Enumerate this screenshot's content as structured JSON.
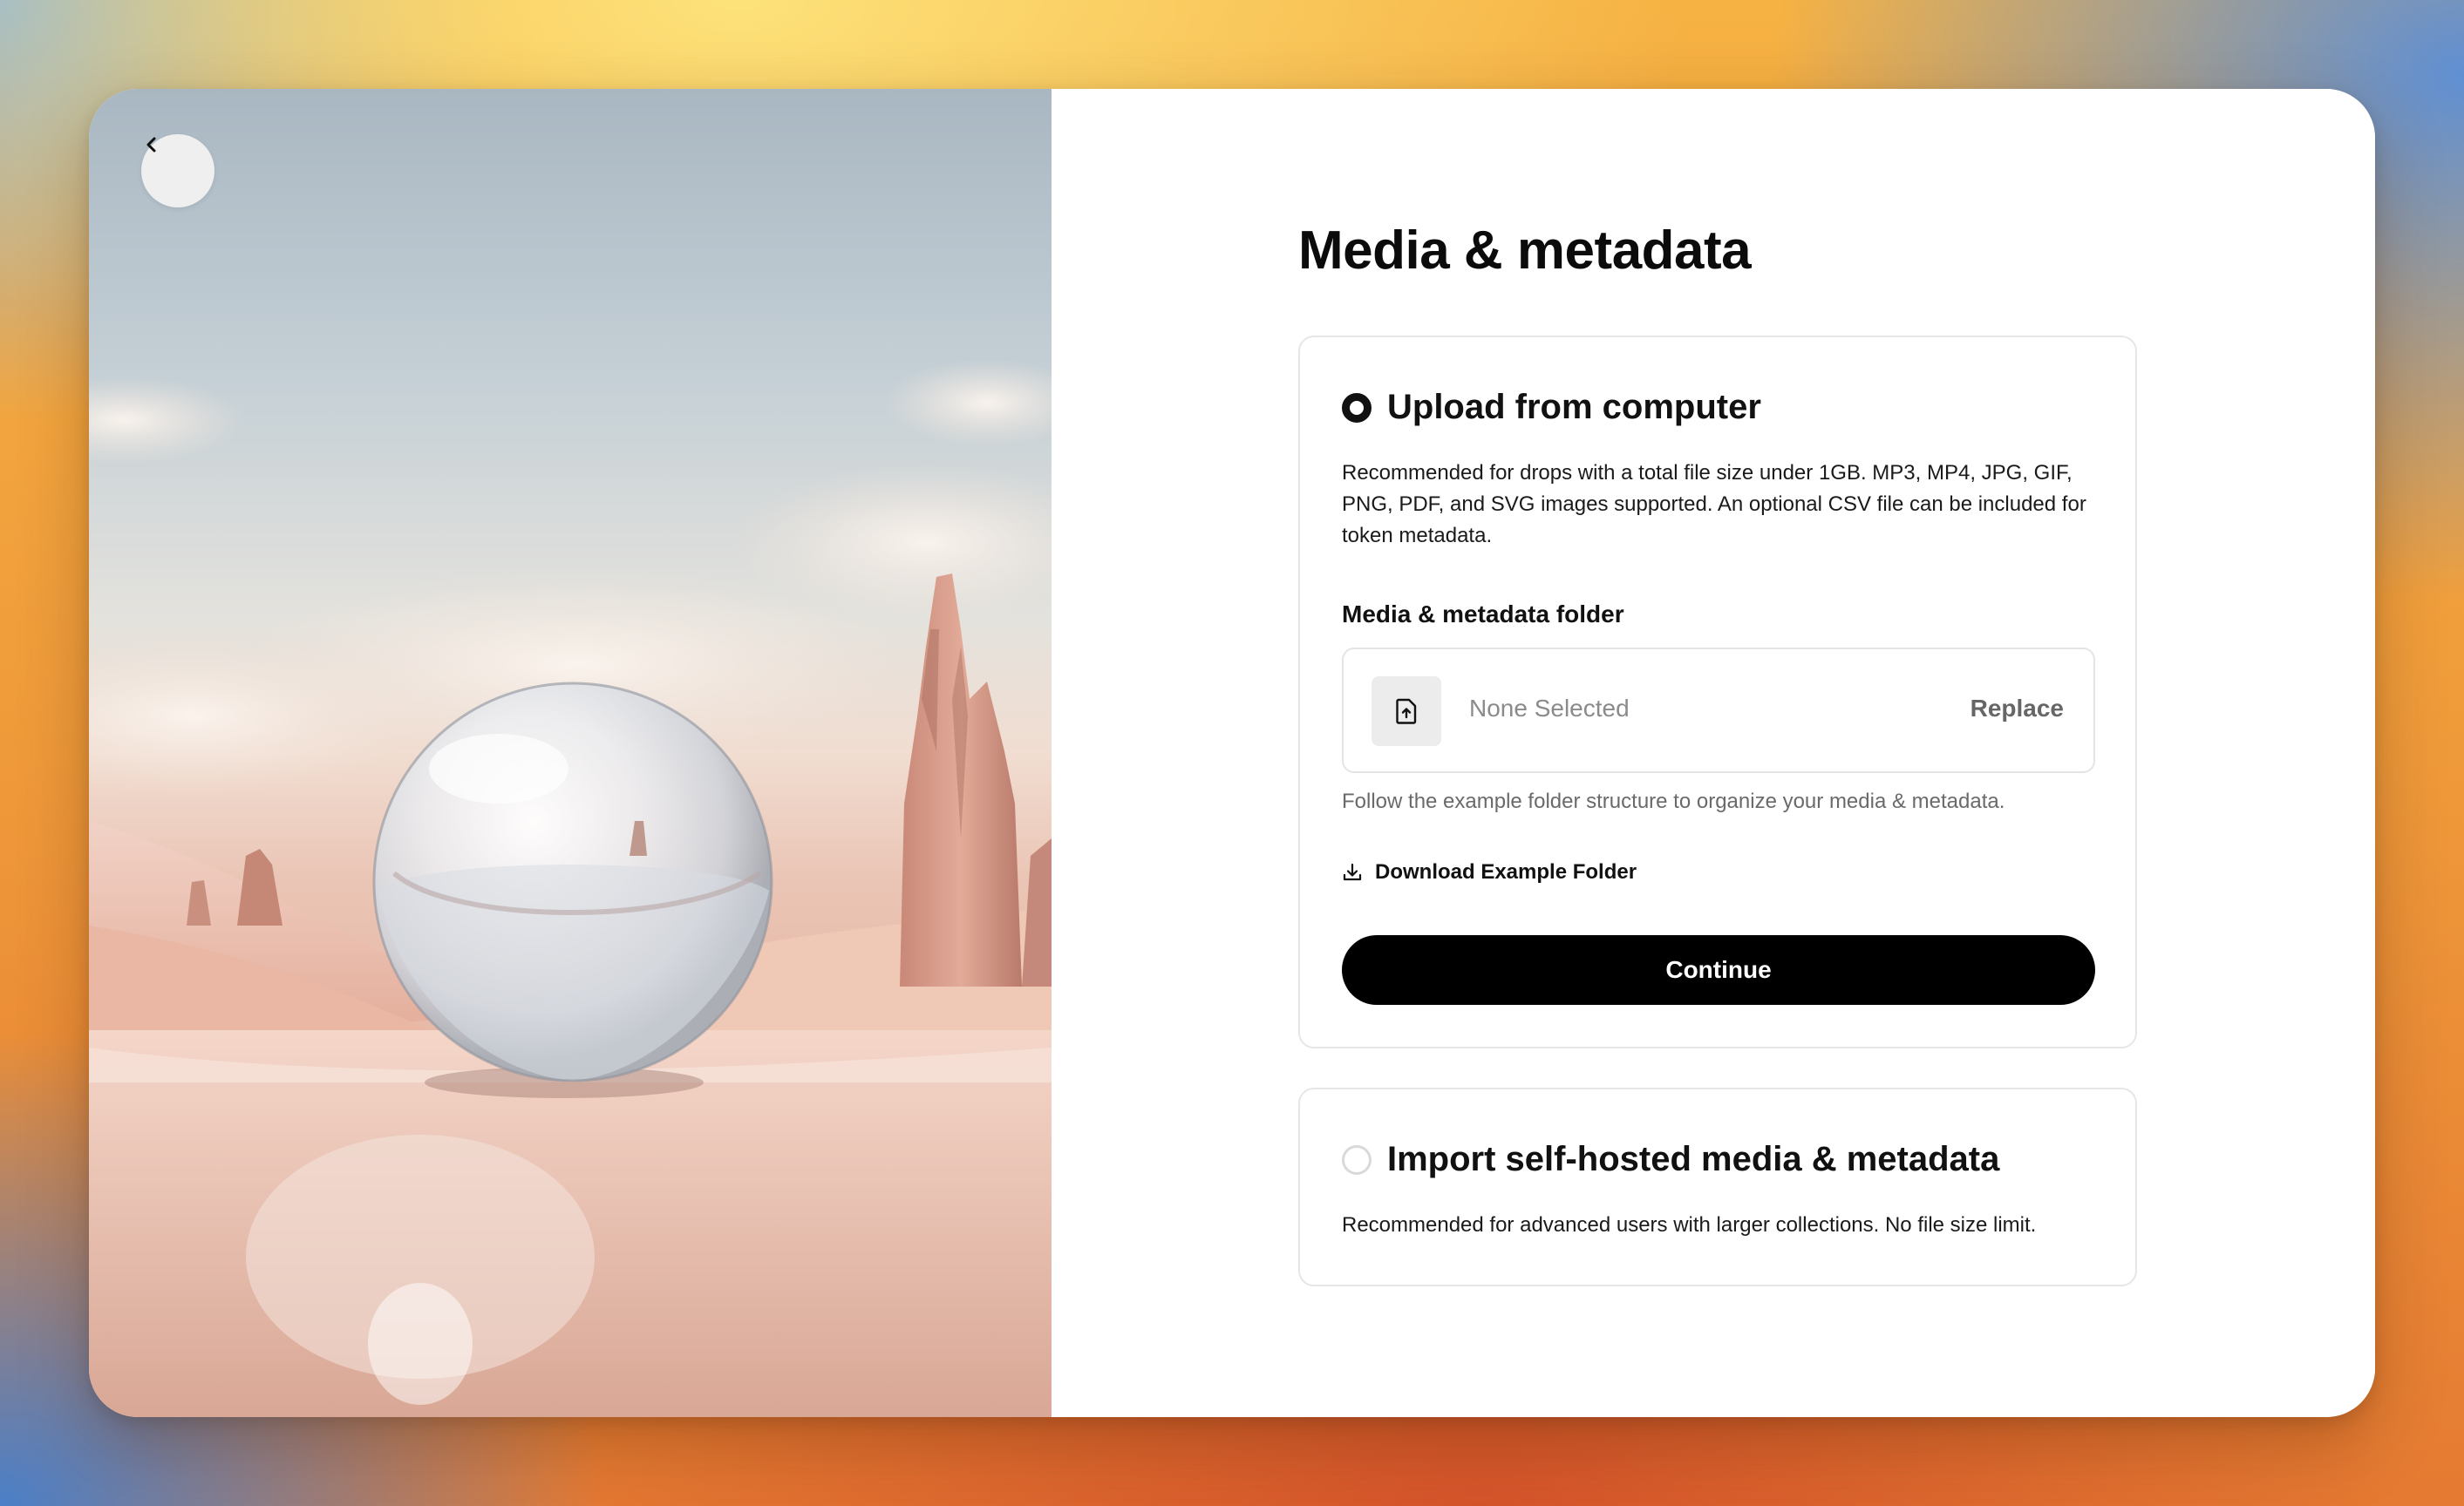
{
  "page": {
    "title": "Media & metadata"
  },
  "back_button": {
    "icon": "chevron-left-icon"
  },
  "option_upload": {
    "label": "Upload from computer",
    "selected": true,
    "description": "Recommended for drops with a total file size under 1GB. MP3, MP4, JPG, GIF, PNG, PDF, and SVG images supported. An optional CSV file can be included for token metadata.",
    "field_label": "Media & metadata folder",
    "file_placeholder": "None Selected",
    "file_icon": "file-upload-icon",
    "replace_label": "Replace",
    "hint": "Follow the example folder structure to organize your media & metadata.",
    "download_label": "Download Example Folder",
    "download_icon": "download-icon",
    "continue_label": "Continue"
  },
  "option_import": {
    "label": "Import self-hosted media & metadata",
    "selected": false,
    "description": "Recommended for advanced users with larger collections. No file size limit."
  },
  "colors": {
    "primary_button": "#000000",
    "radio_selected": "#111111",
    "radio_unselected": "#d9d9d9"
  }
}
